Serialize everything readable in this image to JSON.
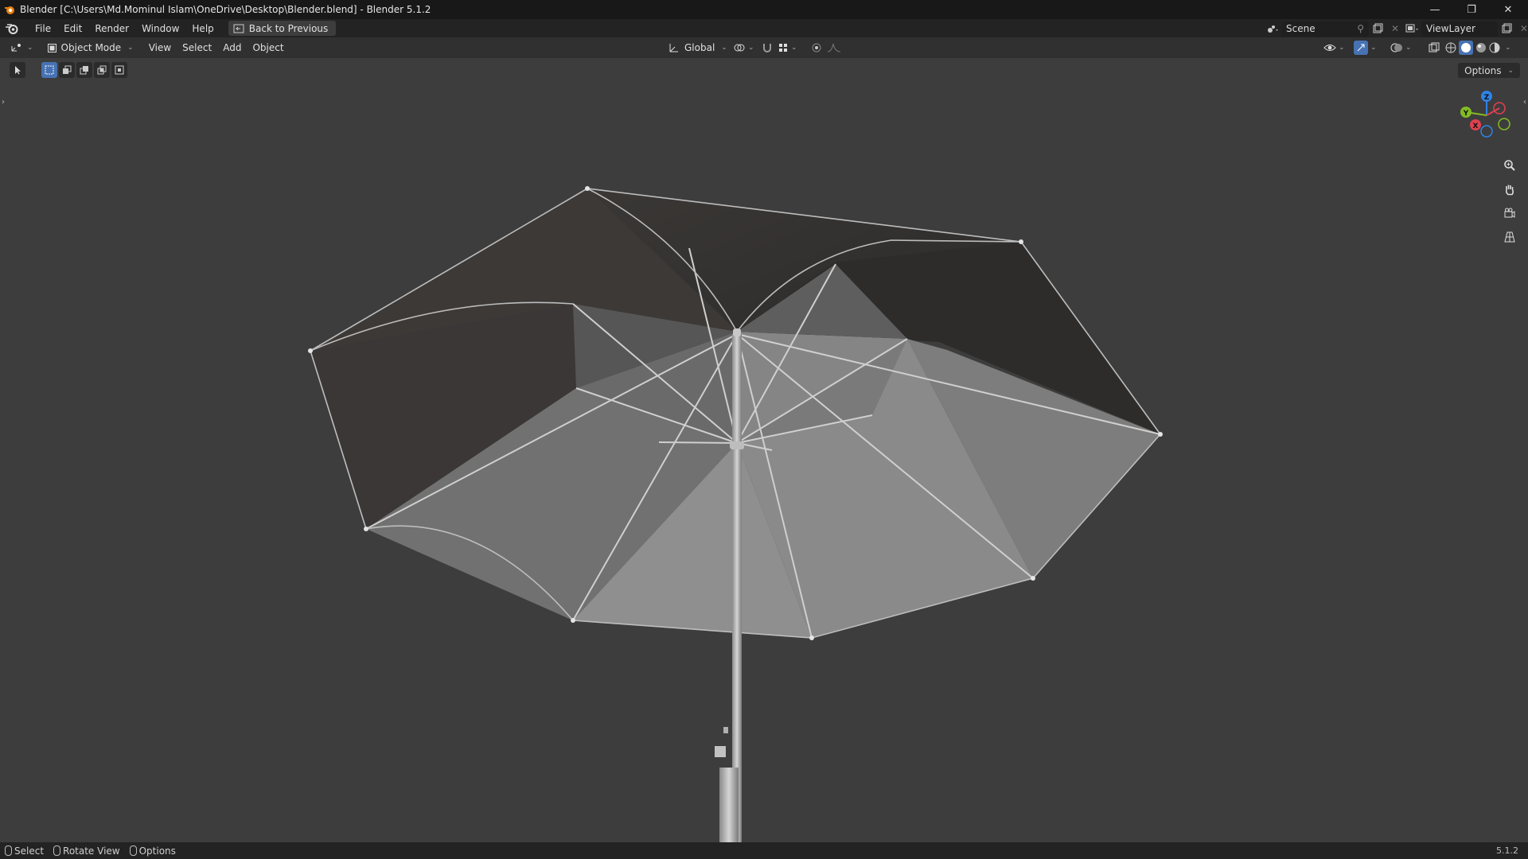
{
  "window": {
    "title": "Blender [C:\\Users\\Md.Mominul Islam\\OneDrive\\Desktop\\Blender.blend] - Blender 5.1.2",
    "controls": {
      "minimize": "—",
      "restore": "❐",
      "close": "✕"
    }
  },
  "menu": {
    "items": [
      "File",
      "Edit",
      "Render",
      "Window",
      "Help"
    ],
    "back_label": "Back to Previous"
  },
  "scene": {
    "name": "Scene",
    "view_layer": "ViewLayer"
  },
  "viewport_header": {
    "mode": "Object Mode",
    "menus": [
      "View",
      "Select",
      "Add",
      "Object"
    ],
    "transform_orientation": "Global",
    "options_label": "Options"
  },
  "status": {
    "items": [
      "Select",
      "Rotate View",
      "Options"
    ],
    "version": "5.1.2"
  },
  "gizmo": {
    "x": "X",
    "y": "Y",
    "z": "Z"
  },
  "colors": {
    "accent": "#4772b3",
    "x_axis": "#e0414f",
    "y_axis": "#84bb23",
    "z_axis": "#2f83e8",
    "viewport": "#3d3d3d"
  }
}
